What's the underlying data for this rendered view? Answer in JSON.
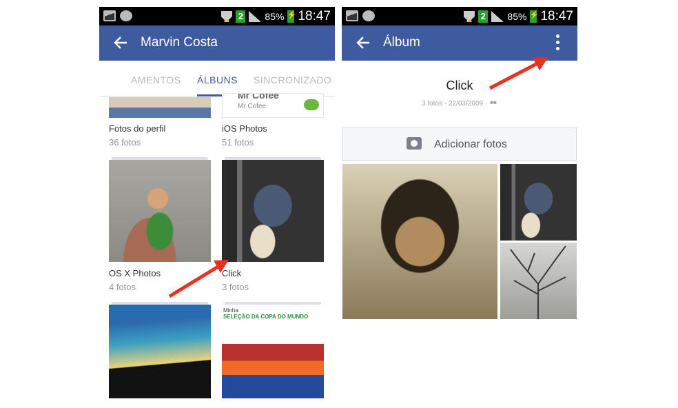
{
  "status_bar": {
    "battery": "85%",
    "badge": "2",
    "time": "18:47"
  },
  "left_screen": {
    "title": "Marvin Costa",
    "tabs": [
      "AMENTOS",
      "ÁLBUNS",
      "SINCRONIZADO"
    ],
    "albums": [
      {
        "name": "Fotos do perfil",
        "count": "36 fotos"
      },
      {
        "name": "iOS Photos",
        "count": "51 fotos",
        "preview_title": "Mr Cofee",
        "preview_sub": "Mr Cofee"
      },
      {
        "name": "OS X Photos",
        "count": "4 fotos"
      },
      {
        "name": "Click",
        "count": "3 fotos"
      },
      {
        "name": "",
        "count": ""
      },
      {
        "name": "",
        "count": "",
        "preview_title_prefix": "Minha",
        "preview_title": "SELEÇÃO DA COPA DO MUNDO"
      }
    ]
  },
  "right_screen": {
    "title": "Álbum",
    "album_title": "Click",
    "album_meta": "3 fotos · 22/03/2009 ·",
    "add_photos_label": "Adicionar fotos"
  },
  "colors": {
    "facebook_blue": "#3f5b9f",
    "arrow_red": "#e8321f"
  }
}
